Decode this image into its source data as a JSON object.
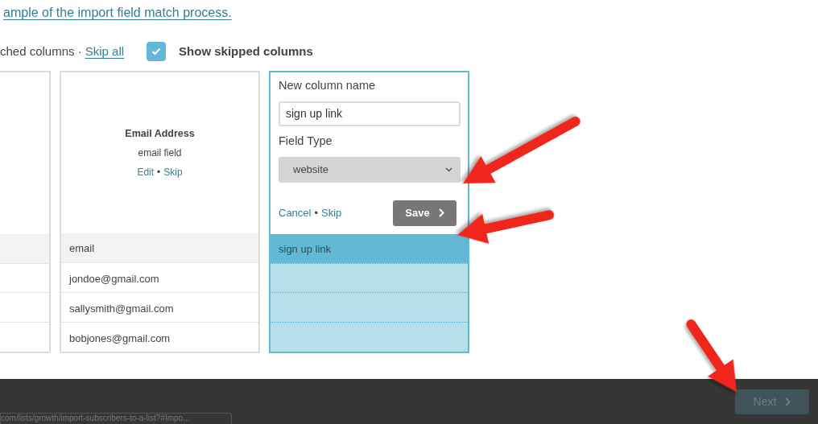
{
  "intro_link": "ample of the import field match process.",
  "toolbar": {
    "matched_text": "ched columns ·",
    "skip_all_link": "Skip all",
    "show_skipped": {
      "label": "Show skipped columns",
      "checked": true
    }
  },
  "columns": [
    {
      "kind": "cut",
      "selected": false
    },
    {
      "kind": "matched",
      "selected": false,
      "title": "Email Address",
      "subtitle": "email field",
      "actions": [
        "Edit",
        "Skip"
      ],
      "separator": "•",
      "header_cell": "email",
      "cells": [
        "jondoe@gmail.com",
        "sallysmith@gmail.com",
        "bobjones@gmail.com"
      ]
    },
    {
      "kind": "editing",
      "selected": true,
      "name_label": "New column name",
      "name_value": "sign up link",
      "type_label": "Field Type",
      "type_value": "website",
      "actions": [
        "Cancel",
        "Skip"
      ],
      "separator": "•",
      "save_label": "Save",
      "header_cell": "sign up link"
    }
  ],
  "footer": {
    "next_label": "Next",
    "next_disabled": true,
    "status_url": "com/lists/growth/import-subscribers-to-a-list?#Impo..."
  }
}
